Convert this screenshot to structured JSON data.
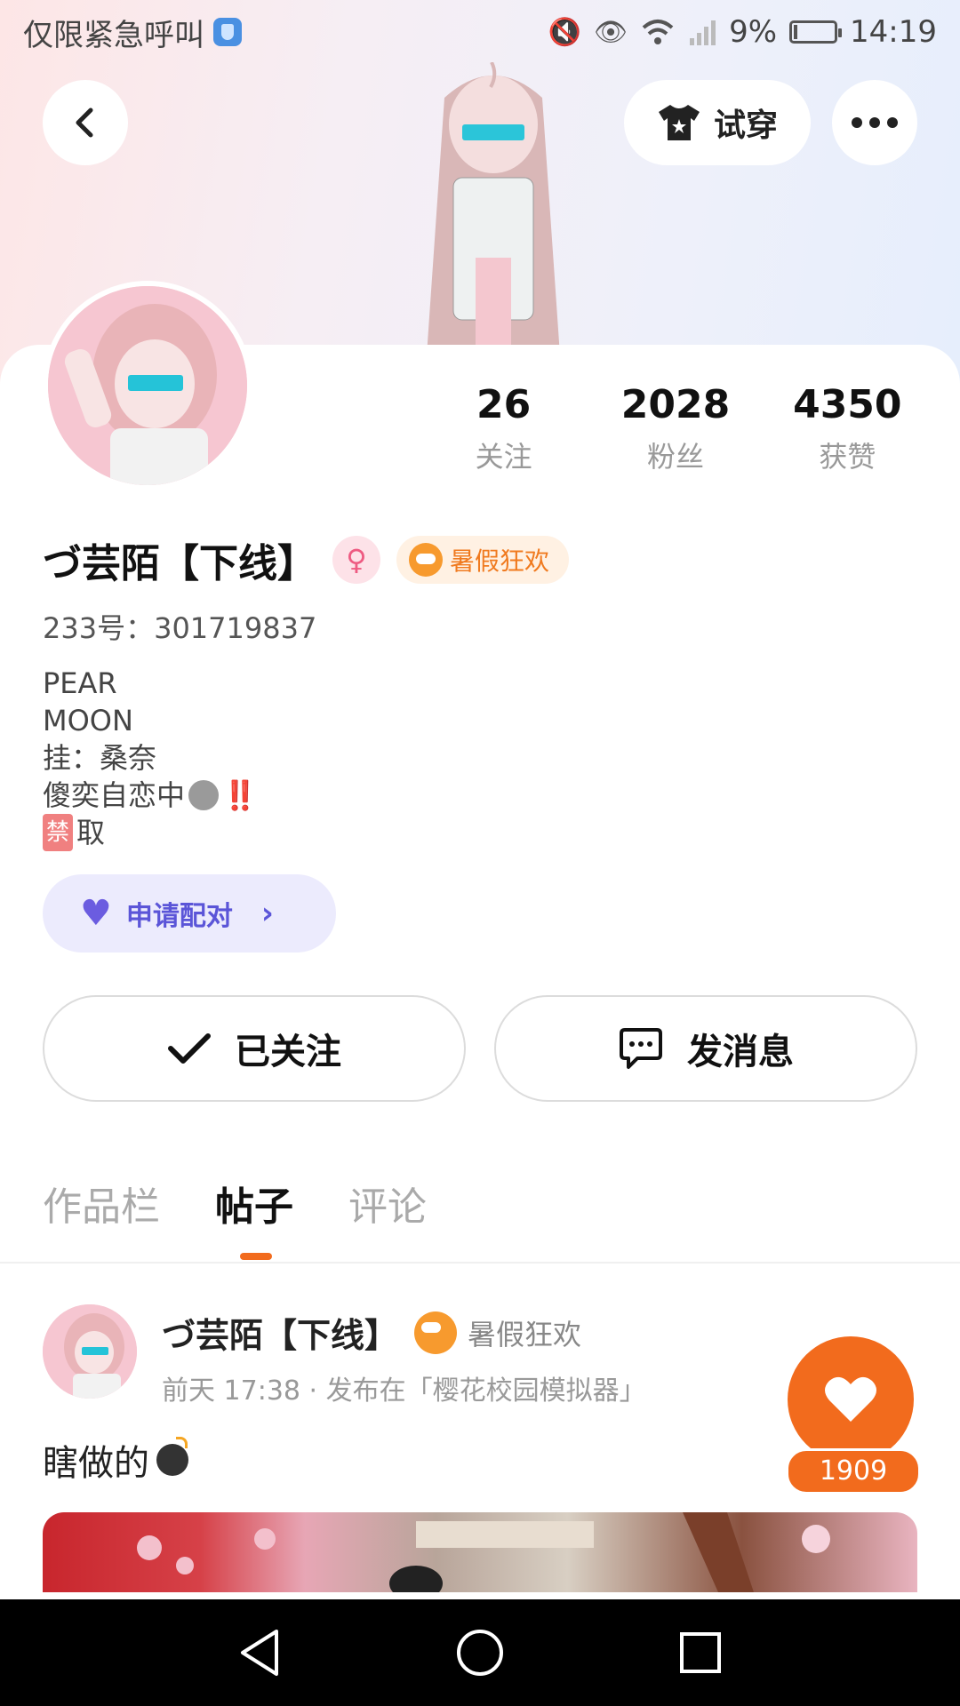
{
  "status_bar": {
    "left_text": "仅限紧急呼叫",
    "battery": "9%",
    "battery_level": 0.09,
    "time": "14:19"
  },
  "header": {
    "tryon_label": "试穿",
    "icons": [
      "back-arrow-icon",
      "tshirt-icon",
      "more-icon"
    ]
  },
  "profile": {
    "stats": [
      {
        "value": "26",
        "label": "关注"
      },
      {
        "value": "2028",
        "label": "粉丝"
      },
      {
        "value": "4350",
        "label": "获赞"
      }
    ],
    "name": "づ芸陌【下线】",
    "gender_icon": "female-icon",
    "event_badge": "暑假狂欢",
    "uid": "233号：301719837",
    "bio_lines": [
      "PEAR",
      "MOON",
      "挂：桑奈",
      "傻奕自恋中",
      "‼️",
      "禁",
      "取"
    ],
    "pair_label": "申请配对",
    "follow_label": "已关注",
    "message_label": "发消息"
  },
  "tabs": [
    {
      "label": "作品栏",
      "active": false
    },
    {
      "label": "帖子",
      "active": true
    },
    {
      "label": "评论",
      "active": false
    }
  ],
  "post": {
    "author": "づ芸陌【下线】",
    "event_badge": "暑假狂欢",
    "meta": "前天 17:38 · 发布在「樱花校园模拟器」",
    "text": "瞎做的",
    "likes": "1909"
  },
  "colors": {
    "accent": "#f26b1d",
    "pair_purple": "#5b55d8",
    "event_orange": "#f07a1f"
  }
}
